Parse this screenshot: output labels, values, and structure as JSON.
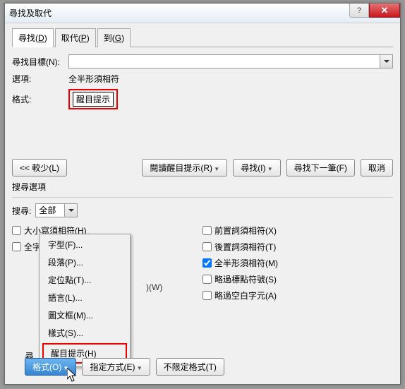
{
  "title": "尋找及取代",
  "tabs": [
    {
      "label": "尋找",
      "key": "D"
    },
    {
      "label": "取代",
      "key": "P"
    },
    {
      "label": "到",
      "key": "G"
    }
  ],
  "find_label": "尋找目標(N):",
  "options_label": "選項:",
  "options_value": "全半形須相符",
  "format_label": "格式:",
  "format_value": "醒目提示",
  "buttons": {
    "less": "<< 較少(L)",
    "read_highlight": "閱讀醒目提示(R)",
    "find_in": "尋找(I)",
    "find_next": "尋找下一筆(F)",
    "cancel": "取消"
  },
  "search_options_label": "搜尋選項",
  "search_label": "搜尋:",
  "search_value": "全部",
  "left_checks": [
    {
      "label": "大小寫須相符(H)",
      "checked": false
    },
    {
      "label": "全字拼寫須相符(Y)",
      "checked": false
    }
  ],
  "right_checks": [
    {
      "label": "前置詞須相符(X)",
      "checked": false
    },
    {
      "label": "後置詞須相符(T)",
      "checked": false
    },
    {
      "label": "全半形須相符(M)",
      "checked": true
    },
    {
      "label": "略過標點符號(S)",
      "checked": false
    },
    {
      "label": "略過空白字元(A)",
      "checked": false
    }
  ],
  "menu": [
    "字型(F)...",
    "段落(P)...",
    "定位點(T)...",
    "語言(L)...",
    "圖文框(M)...",
    "樣式(S)...",
    "醒目提示(H)"
  ],
  "after_menu_text": ")(W)",
  "bottom_section_label": "尋",
  "bottom": {
    "format": "格式(O)",
    "special": "指定方式(E)",
    "noformat": "不限定格式(T)"
  }
}
